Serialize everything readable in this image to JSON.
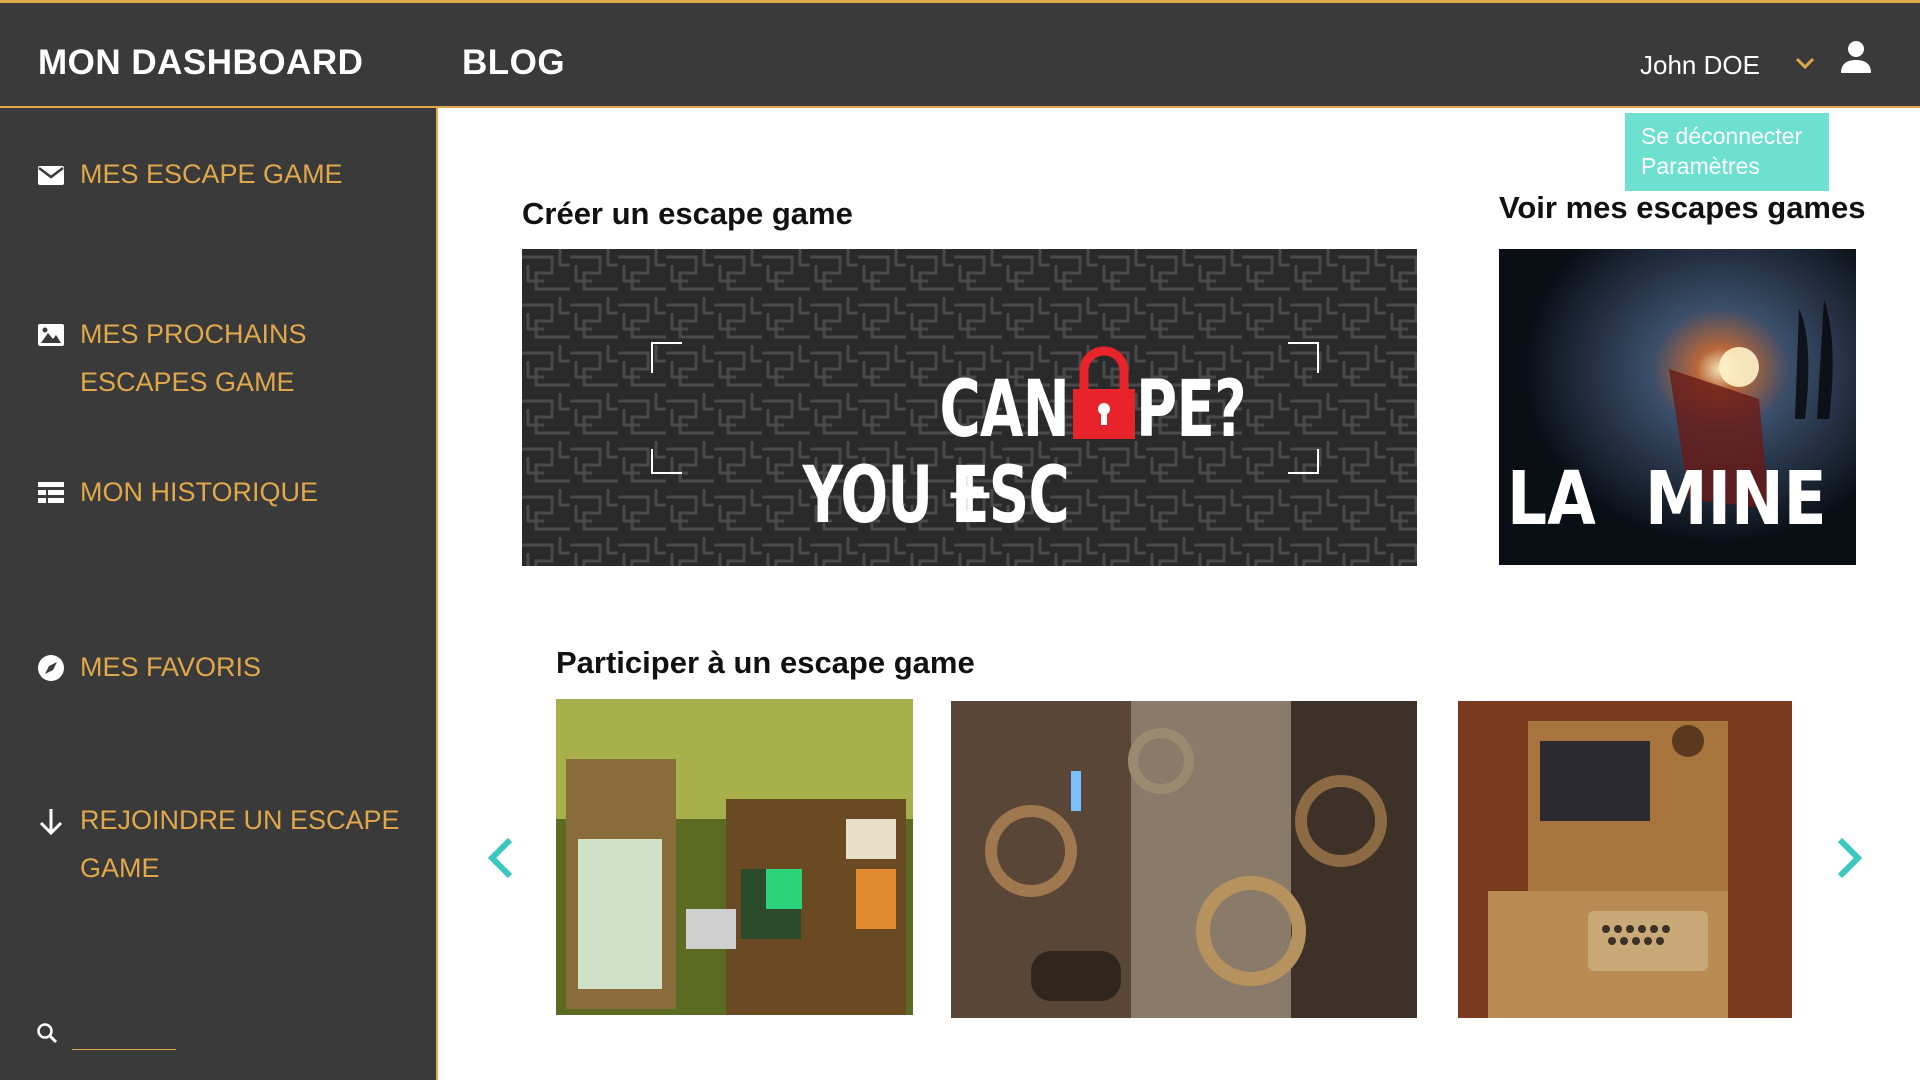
{
  "header": {
    "brand": "MON DASHBOARD",
    "blog": "BLOG",
    "username": "John DOE",
    "menu_items": [
      "Se déconnecter",
      "Paramètres"
    ]
  },
  "sidebar": {
    "items": [
      {
        "label": "MES ESCAPE GAME",
        "icon": "envelope-icon"
      },
      {
        "label": "MES PROCHAINS ESCAPES GAME",
        "icon": "image-icon"
      },
      {
        "label": "MON HISTORIQUE",
        "icon": "list-icon"
      },
      {
        "label": "MES FAVORIS",
        "icon": "compass-icon"
      },
      {
        "label": "REJOINDRE UN ESCAPE GAME",
        "icon": "arrow-down-icon"
      }
    ],
    "search_icon": "search-icon"
  },
  "main": {
    "create_title": "Créer un escape game",
    "create_banner_text": "CAN YOU ESC",
    "create_banner_text_end": "PE?",
    "create_plus": "+",
    "view_title": "Voir mes escapes games",
    "view_card_text_a": "LA",
    "view_card_text_b": "MINE",
    "join_title": "Participer à un escape game"
  },
  "colors": {
    "dark": "#3a3a3a",
    "accent": "#e0a84a",
    "teal": "#6de0cf",
    "lock_red": "#e8242a"
  }
}
